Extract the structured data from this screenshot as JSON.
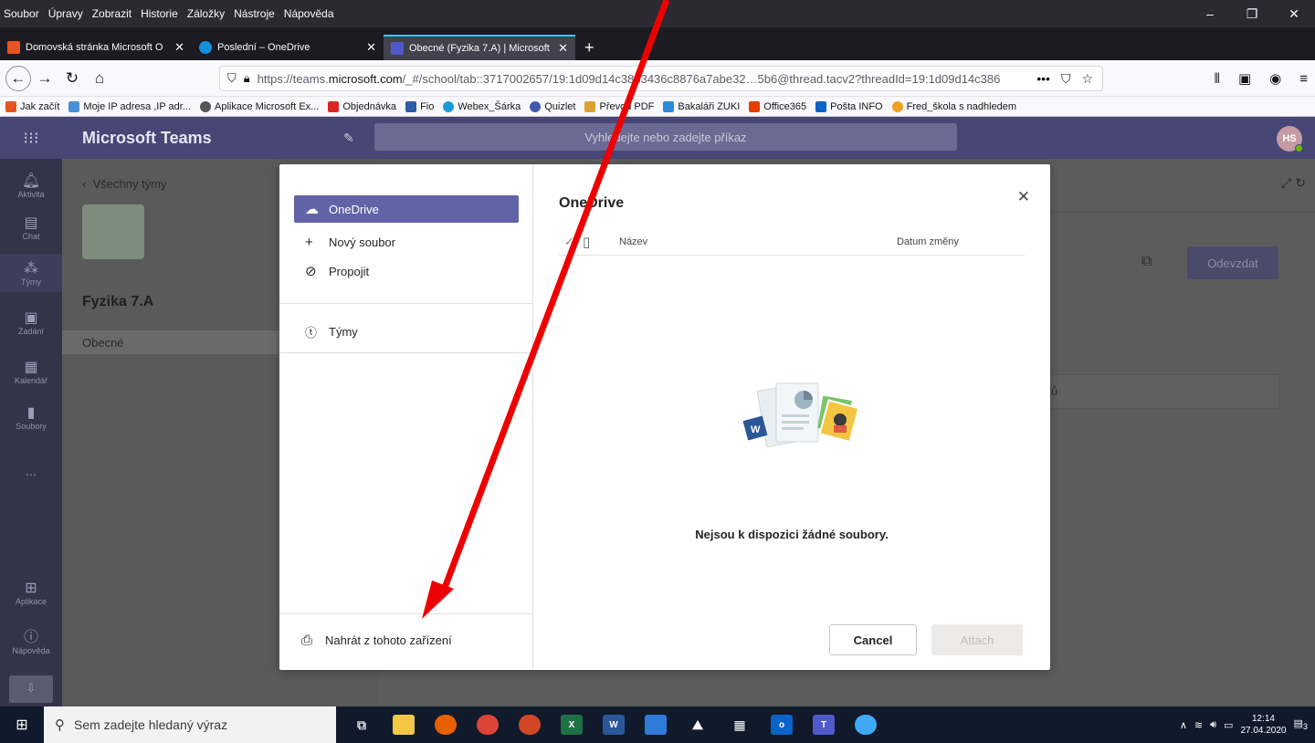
{
  "browser": {
    "menu": [
      "Soubor",
      "Úpravy",
      "Zobrazit",
      "Historie",
      "Záložky",
      "Nástroje",
      "Nápověda"
    ],
    "tabs": [
      {
        "label": "Domovská stránka Microsoft O",
        "color": "#e8541f"
      },
      {
        "label": "Poslední – OneDrive",
        "color": "#1490df"
      },
      {
        "label": "Obecné (Fyzika 7.A) | Microsoft",
        "color": "#5059c9"
      }
    ],
    "url_prefix": "https://teams.",
    "url_domain": "microsoft.com",
    "url_rest": "/_#/school/tab::3717002657/19:1d09d14c3863436c8876a7abe32…5b6@thread.tacv2?threadId=19:1d09d14c386",
    "bookmarks": [
      {
        "label": "Jak začít",
        "color": "#e8541f"
      },
      {
        "label": "Moje IP adresa ,IP adr...",
        "color": "#4a90d9"
      },
      {
        "label": "Aplikace Microsoft Ex...",
        "color": "#555555"
      },
      {
        "label": "Objednávka",
        "color": "#e02424"
      },
      {
        "label": "Fio",
        "color": "#2d5ca8"
      },
      {
        "label": "Webex_Šárka",
        "color": "#1a9bd7"
      },
      {
        "label": "Quizlet",
        "color": "#4257b2"
      },
      {
        "label": "Převod PDF",
        "color": "#e0a030"
      },
      {
        "label": "Bakaláři ZUKI",
        "color": "#2a8ad8"
      },
      {
        "label": "Office365",
        "color": "#eb3c00"
      },
      {
        "label": "Pošta INFO",
        "color": "#0a64c8"
      },
      {
        "label": "Fred_škola s nadhledem",
        "color": "#f0a020"
      }
    ]
  },
  "teams": {
    "app_name": "Microsoft Teams",
    "search_placeholder": "Vyhledejte nebo zadejte příkaz",
    "avatar": "HS",
    "rail": [
      {
        "label": "Aktivita",
        "icon": "🔔"
      },
      {
        "label": "Chat",
        "icon": "▤"
      },
      {
        "label": "Týmy",
        "icon": "⁂"
      },
      {
        "label": "Zadání",
        "icon": "▣"
      },
      {
        "label": "Kalendář",
        "icon": "▦"
      },
      {
        "label": "Soubory",
        "icon": "▮"
      },
      {
        "label": "...",
        "icon": ""
      },
      {
        "label": "Aplikace",
        "icon": "⊞"
      },
      {
        "label": "Nápověda",
        "icon": "?"
      }
    ],
    "back_label": "Všechny týmy",
    "team_name": "Fyzika 7.A",
    "channel": "Obecné",
    "submit_label": "Odevzdat",
    "obs_text": "stů"
  },
  "modal": {
    "nav": [
      {
        "label": "OneDrive",
        "icon": "☁"
      },
      {
        "label": "Nový soubor",
        "icon": "+"
      },
      {
        "label": "Propojit",
        "icon": "⊘"
      },
      {
        "label": "Týmy",
        "icon": "ⓣ"
      }
    ],
    "upload_label": "Nahrát z tohoto zařízení",
    "title": "OneDrive",
    "col_name": "Název",
    "col_date": "Datum změny",
    "empty_text": "Nejsou k dispozici žádné soubory.",
    "cancel": "Cancel",
    "attach": "Attach"
  },
  "taskbar": {
    "search_placeholder": "Sem zadejte hledaný výraz",
    "time": "12:14",
    "date": "27.04.2020",
    "notif_count": "3"
  },
  "colors": {
    "teams_purple": "#464775",
    "accent": "#6264a7",
    "annotation_arrow": "#ee0000"
  }
}
